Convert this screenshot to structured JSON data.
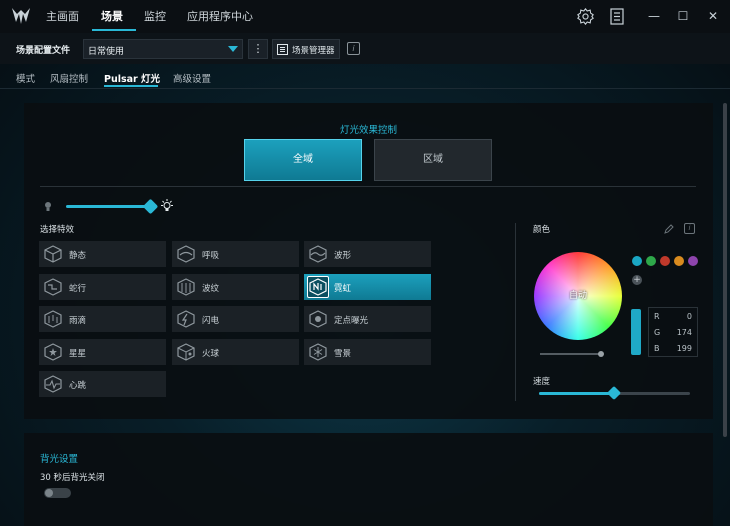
{
  "nav": {
    "tabs": [
      {
        "label": "主画面"
      },
      {
        "label": "场景"
      },
      {
        "label": "监控"
      },
      {
        "label": "应用程序中心"
      }
    ]
  },
  "window": {
    "settings_icon": "gear-icon",
    "panel_icon": "side-panel-icon",
    "min_label": "—",
    "max_label": "☐",
    "close_label": "✕"
  },
  "profile": {
    "label": "场景配置文件",
    "value": "日常使用",
    "more_label": "⋮",
    "manager_label": "场景管理器",
    "info_label": "i"
  },
  "subtabs": [
    {
      "label": "模式"
    },
    {
      "label": "风扇控制"
    },
    {
      "label": "Pulsar 灯光"
    },
    {
      "label": "高级设置"
    }
  ],
  "lighting": {
    "title": "灯光效果控制",
    "mode_global": "全域",
    "mode_zone": "区域",
    "brightness": 1.0,
    "effects_label": "选择特效",
    "effects": [
      {
        "label": "静态",
        "icon": "static-icon"
      },
      {
        "label": "呼吸",
        "icon": "breathing-icon"
      },
      {
        "label": "波形",
        "icon": "wave-icon"
      },
      {
        "label": "蛇行",
        "icon": "snake-icon"
      },
      {
        "label": "波纹",
        "icon": "ripple-icon"
      },
      {
        "label": "霓虹",
        "icon": "neon-icon"
      },
      {
        "label": "雨滴",
        "icon": "raindrop-icon"
      },
      {
        "label": "闪电",
        "icon": "lightning-icon"
      },
      {
        "label": "定点曝光",
        "icon": "spot-icon"
      },
      {
        "label": "星星",
        "icon": "star-icon"
      },
      {
        "label": "火球",
        "icon": "fireball-icon"
      },
      {
        "label": "雪景",
        "icon": "snowflake-icon"
      },
      {
        "label": "心跳",
        "icon": "heartbeat-icon"
      }
    ],
    "selected_effect": "霓虹"
  },
  "color": {
    "label": "颜色",
    "info_label": "i",
    "wheel_label": "自动",
    "swatches": [
      "#1aa7c4",
      "#2ea84a",
      "#c0392b",
      "#d98b1f",
      "#8e44ad"
    ],
    "add_label": "+",
    "r_key": "R",
    "r_value": "0",
    "g_key": "G",
    "g_value": "174",
    "b_key": "B",
    "b_value": "199",
    "accent": "#2ab8d6"
  },
  "speed": {
    "label": "速度",
    "value": 0.5
  },
  "backlight": {
    "title": "背光设置",
    "off_label": "30 秒后背光关闭"
  }
}
